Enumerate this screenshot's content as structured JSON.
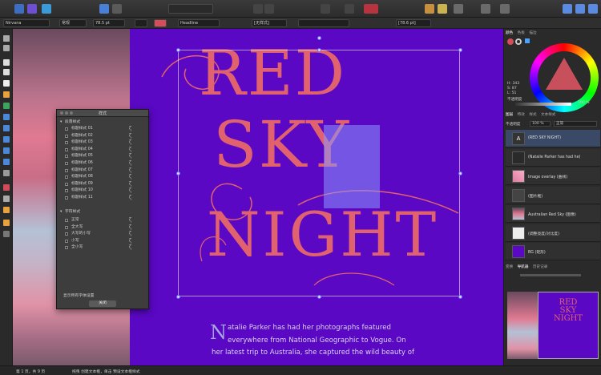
{
  "toolbar": {
    "buttons": [
      {
        "name": "app-logo-icon",
        "color": "#1f7fd6"
      },
      {
        "name": "persona-photo-icon",
        "color": "#3c6fc2"
      },
      {
        "name": "persona-pixel-icon",
        "color": "#6e4fd1"
      },
      {
        "name": "persona-export-icon",
        "color": "#3b9ad8"
      }
    ]
  },
  "context": {
    "font_family": "Nirvana",
    "font_style": "常规",
    "font_size": "78.5 pt",
    "fill_color": "#d54c5b",
    "paragraph_style": "Headline",
    "character_style": "[无样式]",
    "leading": "[78.6 pt]"
  },
  "canvas": {
    "line1": "RED",
    "line2": "SKY",
    "line3": "NIGHT",
    "dropcap": "N",
    "body_lines": [
      "atalie Parker has had her photographs featured",
      "everywhere from National Geographic to Vogue. On",
      "her latest trip to Australia, she captured the wild beauty of"
    ],
    "bg_color": "#5a08c4",
    "heading_color": "#e0626e"
  },
  "styles_window": {
    "title": "样式",
    "group1": "段落样式",
    "group1_items": [
      "标题样式 01",
      "标题样式 02",
      "标题样式 03",
      "标题样式 04",
      "标题样式 05",
      "标题样式 06",
      "标题样式 07",
      "标题样式 08",
      "标题样式 09",
      "标题样式 10",
      "标题样式 11"
    ],
    "group2": "字符样式",
    "group2_items": [
      "正常",
      "全大写",
      "大写的小写",
      "小写",
      "全小写"
    ],
    "footer_label": "显示所有字体设置",
    "close_button": "关闭"
  },
  "right_panel": {
    "color_tabs": [
      "颜色",
      "色板",
      "描边"
    ],
    "hsl": {
      "h": "H: 343",
      "s": "S: 87",
      "l": "L: 51"
    },
    "opacity_label": "不透明度",
    "opacity_value": "100 %",
    "layer_tabs": [
      "图层",
      "特效",
      "样式",
      "文本样式"
    ],
    "blend_label": "不透明度",
    "blend_opacity": "100 %",
    "blend_mode": "正常",
    "layers": [
      {
        "name": "(RED SKY NIGHT)",
        "thumb": "A"
      },
      {
        "name": "(Natalie Parker has had he)",
        "thumb": ""
      },
      {
        "name": "Image overlay (曲线)",
        "thumb": ""
      },
      {
        "name": "(图片框)",
        "thumb": ""
      },
      {
        "name": "Australian Red Sky (图像)",
        "thumb": ""
      },
      {
        "name": "(调整亮度/对比度)",
        "thumb": ""
      },
      {
        "name": "BG (矩形)",
        "thumb": ""
      }
    ],
    "nav_tabs": [
      "变换",
      "导航器",
      "历史记录"
    ],
    "mini_title": [
      "RED",
      "SKY",
      "NIGHT"
    ]
  },
  "status": {
    "page": "第 1 页，共 9 页",
    "hint": "拖曳 创建文本框，单击 预设文本框样式"
  }
}
